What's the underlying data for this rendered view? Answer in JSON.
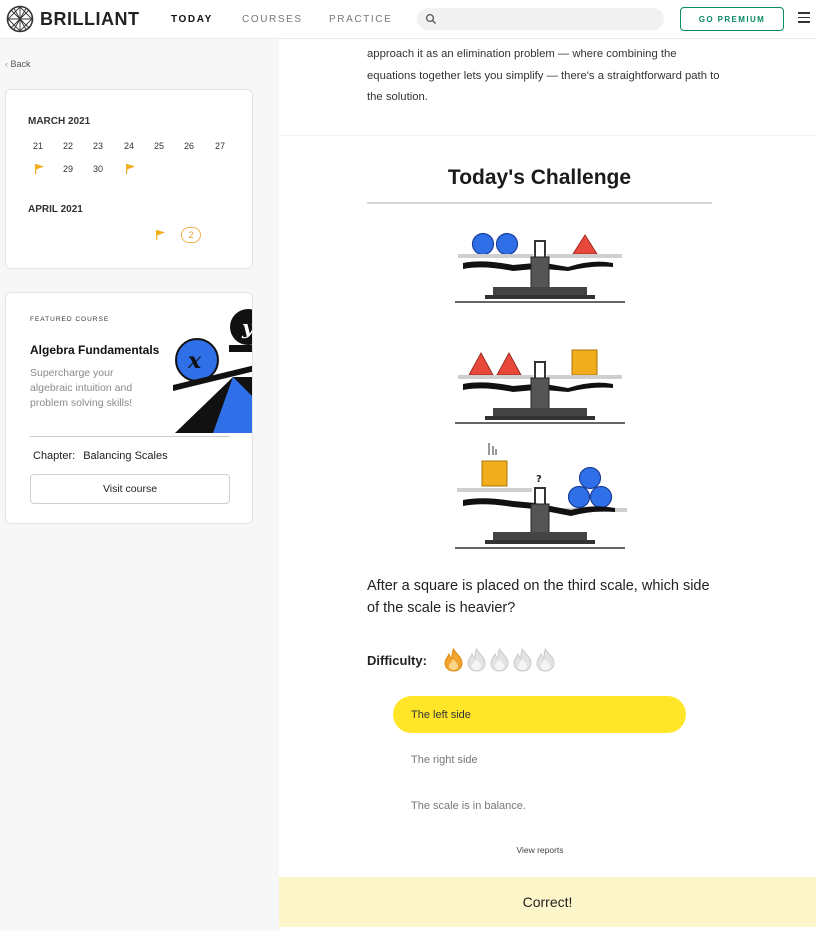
{
  "header": {
    "logo_text": "BRILLIANT",
    "nav": [
      {
        "label": "TODAY",
        "active": true
      },
      {
        "label": "COURSES",
        "active": false
      },
      {
        "label": "PRACTICE",
        "active": false
      }
    ],
    "search_placeholder": "",
    "premium_label": "GO PREMIUM",
    "accent_color": "#0a8a66"
  },
  "sidebar": {
    "back_label": "Back",
    "calendar": {
      "months": [
        {
          "name": "MARCH 2021",
          "row1": [
            "21",
            "22",
            "23",
            "24",
            "25",
            "26",
            "27"
          ],
          "row2": [
            "29",
            "30"
          ]
        },
        {
          "name": "APRIL 2021",
          "badge": "2"
        }
      ],
      "flag_color": "#f2ad1c"
    },
    "course": {
      "featured_label": "FEATURED COURSE",
      "title": "Algebra Fundamentals",
      "description": "Supercharge your algebraic intuition and problem solving skills!",
      "chapter_label": "Chapter:",
      "chapter_value": "Balancing Scales",
      "visit_label": "Visit course",
      "art_text_x": "x",
      "art_text_y": "y"
    }
  },
  "main": {
    "intro": "approach it as an elimination problem — where combining the equations together lets you simplify — there's a straightforward path to the solution.",
    "challenge_title": "Today's Challenge",
    "scale_question_mark": "?",
    "question": "After a square is placed on the third scale, which side of the scale is heavier?",
    "difficulty_label": "Difficulty:",
    "difficulty_level": 1,
    "difficulty_max": 5,
    "answers": [
      {
        "label": "The left side",
        "selected": true
      },
      {
        "label": "The right side",
        "selected": false
      },
      {
        "label": "The scale is in balance.",
        "selected": false
      }
    ],
    "view_reports_label": "View reports",
    "result_label": "Correct!",
    "colors": {
      "circle": "#2f6fe8",
      "triangle": "#e8483a",
      "square": "#f2ad1c",
      "highlight": "#ffe629"
    }
  }
}
